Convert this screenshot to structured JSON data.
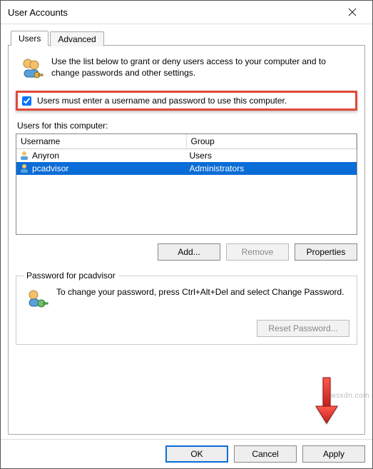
{
  "window": {
    "title": "User Accounts"
  },
  "tabs": [
    {
      "label": "Users",
      "active": true
    },
    {
      "label": "Advanced",
      "active": false
    }
  ],
  "intro": {
    "text": "Use the list below to grant or deny users access to your computer and to change passwords and other settings."
  },
  "require_login": {
    "label": "Users must enter a username and password to use this computer.",
    "checked": true
  },
  "users_section": {
    "heading": "Users for this computer:",
    "columns": {
      "username": "Username",
      "group": "Group"
    },
    "rows": [
      {
        "username": "Anyron",
        "group": "Users",
        "selected": false
      },
      {
        "username": "pcadvisor",
        "group": "Administrators",
        "selected": true
      }
    ],
    "buttons": {
      "add": "Add...",
      "remove": "Remove",
      "properties": "Properties"
    }
  },
  "password_section": {
    "legend": "Password for pcadvisor",
    "text": "To change your password, press Ctrl+Alt+Del and select Change Password.",
    "reset_button": "Reset Password..."
  },
  "dialog_buttons": {
    "ok": "OK",
    "cancel": "Cancel",
    "apply": "Apply"
  },
  "watermark": "wsxdn.com"
}
